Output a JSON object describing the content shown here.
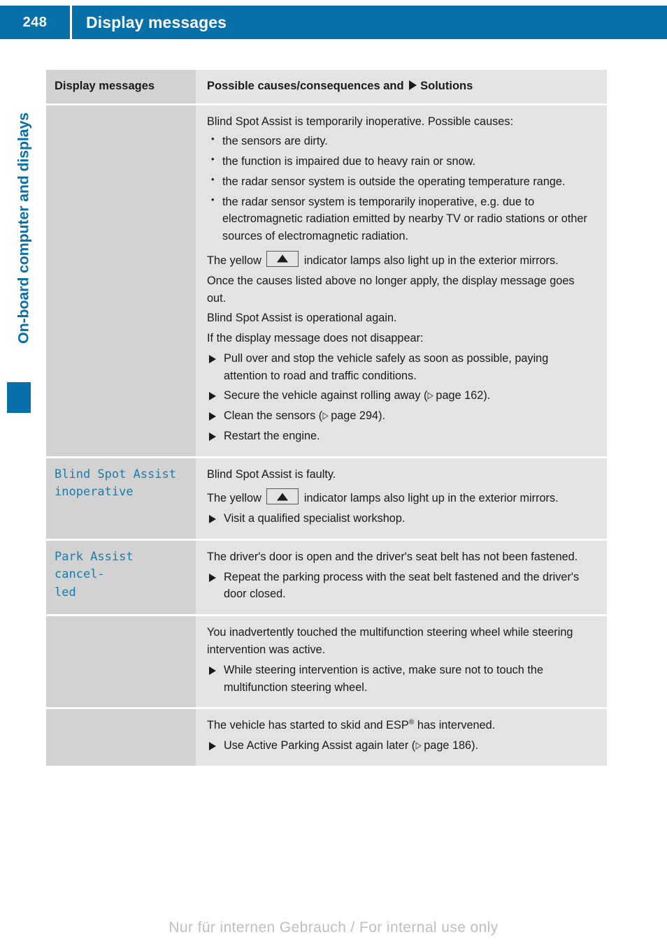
{
  "header": {
    "page_number": "248",
    "title": "Display messages",
    "bar_color": "#0870a8"
  },
  "sidebar": {
    "chapter_label": "On-board computer and displays",
    "accent_color": "#0870a8"
  },
  "table": {
    "columns": {
      "left_header": "Display messages",
      "right_header_before": "Possible causes/consequences and",
      "right_header_after": "Solutions"
    },
    "rows": [
      {
        "message": "",
        "blocks": [
          {
            "type": "paragraph",
            "text": "Blind Spot Assist is temporarily inoperative. Possible causes:"
          },
          {
            "type": "bullet",
            "text": "the sensors are dirty."
          },
          {
            "type": "bullet",
            "text": "the function is impaired due to heavy rain or snow."
          },
          {
            "type": "bullet",
            "text": "the radar sensor system is outside the operating temperature range."
          },
          {
            "type": "bullet",
            "text": "the radar sensor system is temporarily inoperative, e.g. due to electromagnetic radiation emitted by nearby TV or radio stations or other sources of electromagnetic radiation."
          },
          {
            "type": "lamp-paragraph",
            "before": "The yellow",
            "after": "indicator lamps also light up in the exterior mirrors."
          },
          {
            "type": "paragraph",
            "text": "Once the causes listed above no longer apply, the display message goes out."
          },
          {
            "type": "paragraph",
            "text": "Blind Spot Assist is operational again."
          },
          {
            "type": "paragraph",
            "text": "If the display message does not disappear:"
          },
          {
            "type": "step",
            "text": "Pull over and stop the vehicle safely as soon as possible, paying attention to road and traffic conditions."
          },
          {
            "type": "step-ref",
            "before": "Secure the vehicle against rolling away (",
            "ref": "page 162",
            "after": ")."
          },
          {
            "type": "step-ref",
            "before": "Clean the sensors (",
            "ref": "page 294",
            "after": ")."
          },
          {
            "type": "step",
            "text": "Restart the engine."
          }
        ]
      },
      {
        "message": "Blind Spot Assist\ninoperative",
        "blocks": [
          {
            "type": "paragraph",
            "text": "Blind Spot Assist is faulty."
          },
          {
            "type": "lamp-paragraph",
            "before": "The yellow",
            "after": "indicator lamps also light up in the exterior mirrors."
          },
          {
            "type": "step",
            "text": "Visit a qualified specialist workshop."
          }
        ]
      },
      {
        "message": "Park Assist cancel-\nled",
        "blocks": [
          {
            "type": "paragraph",
            "text": "The driver's door is open and the driver's seat belt has not been fastened."
          },
          {
            "type": "step",
            "text": "Repeat the parking process with the seat belt fastened and the driver's door closed."
          }
        ]
      },
      {
        "message": "",
        "blocks": [
          {
            "type": "paragraph",
            "text": "You inadvertently touched the multifunction steering wheel while steering intervention was active."
          },
          {
            "type": "step",
            "text": "While steering intervention is active, make sure not to touch the multifunction steering wheel."
          }
        ]
      },
      {
        "message": "",
        "blocks": [
          {
            "type": "paragraph-esp",
            "before": "The vehicle has started to skid and ESP",
            "sup": "®",
            "after": " has intervened."
          },
          {
            "type": "step-ref",
            "before": "Use Active Parking Assist again later (",
            "ref": "page 186",
            "after": ")."
          }
        ]
      }
    ]
  },
  "footer": {
    "watermark": "Nur für internen Gebrauch / For internal use only"
  }
}
